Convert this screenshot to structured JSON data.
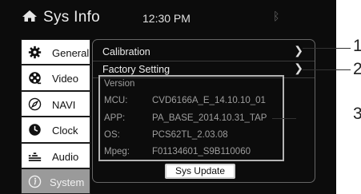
{
  "header": {
    "title": "Sys Info",
    "time": "12:30 PM",
    "home_icon": "home-icon",
    "bluetooth_icon": "bluetooth-icon"
  },
  "sidebar": {
    "items": [
      {
        "label": "General",
        "icon": "gear-icon"
      },
      {
        "label": "Video",
        "icon": "film-reel-icon"
      },
      {
        "label": "NAVI",
        "icon": "compass-icon"
      },
      {
        "label": "Clock",
        "icon": "clock-icon"
      },
      {
        "label": "Audio",
        "icon": "equalizer-icon"
      },
      {
        "label": "System",
        "icon": "info-icon",
        "active": true
      }
    ]
  },
  "panel": {
    "calibration": "Calibration",
    "factory_setting": "Factory Setting"
  },
  "version": {
    "heading": "Version",
    "rows": [
      {
        "key": "MCU:",
        "value": "CVD6166A_E_14.10.10_01"
      },
      {
        "key": "APP:",
        "value": "PA_BASE_2014.10.31_TAP"
      },
      {
        "key": "OS:",
        "value": "PCS62TL_2.03.08"
      },
      {
        "key": "Mpeg:",
        "value": "F01134601_S9B110060"
      }
    ]
  },
  "update_button": "Sys Update",
  "callouts": [
    "1",
    "2",
    "3"
  ]
}
